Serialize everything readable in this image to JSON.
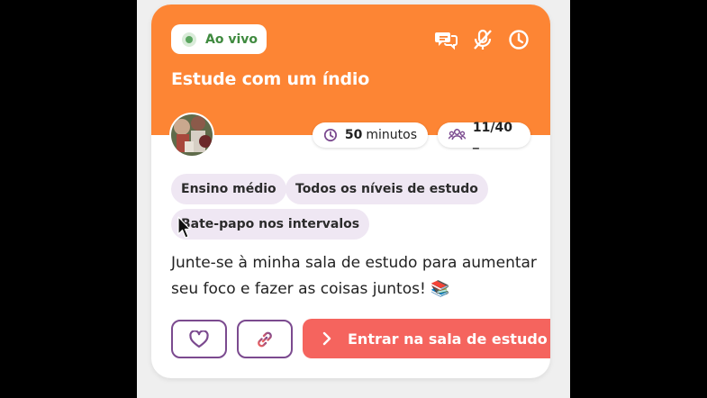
{
  "room": {
    "status": "Ao vivo",
    "title": "Estude com um índio",
    "duration_value": "50",
    "duration_unit": "minutos",
    "participants": "11/40 _",
    "tags": [
      "Ensino médio",
      "Todos os níveis de estudo",
      "Bate-papo nos intervalos"
    ],
    "description_line1": "Junte-se à minha sala de estudo para aumentar",
    "description_line2": "seu foco e fazer as coisas juntos! 📚"
  },
  "actions": {
    "enter_label": "Entrar na sala de estudo"
  },
  "icons": {
    "header": [
      "chat-bubbles-icon",
      "mic-off-icon",
      "clock-icon"
    ],
    "pill_time": "clock-icon",
    "pill_users": "users-icon",
    "favorite": "heart-icon",
    "link": "link-icon",
    "enter": "chevron-right-icon"
  },
  "colors": {
    "header": "#fd8534",
    "live_green": "#3f8a3f",
    "tag_bg": "#efe7f3",
    "outline_purple": "#7b4a8f",
    "enter_button": "#f5645e"
  }
}
